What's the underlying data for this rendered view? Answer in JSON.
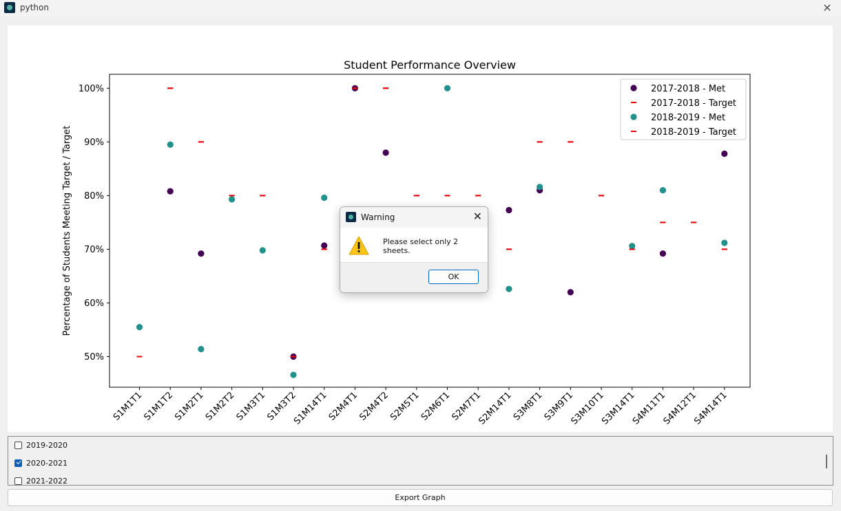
{
  "window": {
    "title": "python"
  },
  "chart_data": {
    "type": "scatter",
    "title": "Student Performance Overview",
    "xlabel": "",
    "ylabel": "Percentage of Students Meeting Target / Target",
    "categories": [
      "S1M1T1",
      "S1M1T2",
      "S1M2T1",
      "S1M2T2",
      "S1M3T1",
      "S1M3T2",
      "S1M14T1",
      "S2M4T1",
      "S2M4T2",
      "S2M5T1",
      "S2M6T1",
      "S2M7T1",
      "S2M14T1",
      "S3M8T1",
      "S3M9T1",
      "S3M10T1",
      "S3M14T1",
      "S4M11T1",
      "S4M12T1",
      "S4M14T1"
    ],
    "yticks": [
      50,
      60,
      70,
      80,
      90,
      100
    ],
    "ytick_labels": [
      "50%",
      "60%",
      "70%",
      "80%",
      "90%",
      "100%"
    ],
    "ylim": [
      44.3,
      102.6
    ],
    "grid": false,
    "legend_position": "top-right",
    "series": [
      {
        "name": "2017-2018 - Met",
        "marker": "dot",
        "color": "#440154",
        "values": [
          null,
          80.8,
          69.2,
          null,
          null,
          50,
          70.7,
          100,
          88,
          null,
          null,
          null,
          77.3,
          81,
          62,
          null,
          null,
          69.2,
          null,
          87.8
        ]
      },
      {
        "name": "2017-2018 - Target",
        "marker": "dash",
        "color": "#e8000b",
        "values": [
          50,
          100,
          90,
          80,
          80,
          50,
          70,
          100,
          100,
          80,
          80,
          80,
          70,
          90,
          90,
          80,
          70,
          75,
          75,
          70
        ]
      },
      {
        "name": "2018-2019 - Met",
        "marker": "dot",
        "color": "#21918c",
        "values": [
          55.5,
          89.5,
          51.4,
          79.3,
          69.8,
          46.6,
          79.6,
          null,
          null,
          null,
          100,
          null,
          62.6,
          81.6,
          null,
          null,
          70.6,
          81,
          null,
          71.2
        ]
      },
      {
        "name": "2018-2019 - Target",
        "marker": "dash",
        "color": "#e8000b",
        "values": [
          50,
          100,
          90,
          80,
          80,
          50,
          70,
          100,
          100,
          80,
          80,
          80,
          70,
          90,
          90,
          80,
          70,
          75,
          75,
          70
        ]
      }
    ]
  },
  "years_list": [
    {
      "label": "2019-2020",
      "checked": false
    },
    {
      "label": "2020-2021",
      "checked": true
    },
    {
      "label": "2021-2022",
      "checked": false
    }
  ],
  "export_button": {
    "label": "Export Graph"
  },
  "dialog": {
    "title": "Warning",
    "message": "Please select only 2 sheets.",
    "ok_label": "OK",
    "icon": "warning-icon"
  }
}
